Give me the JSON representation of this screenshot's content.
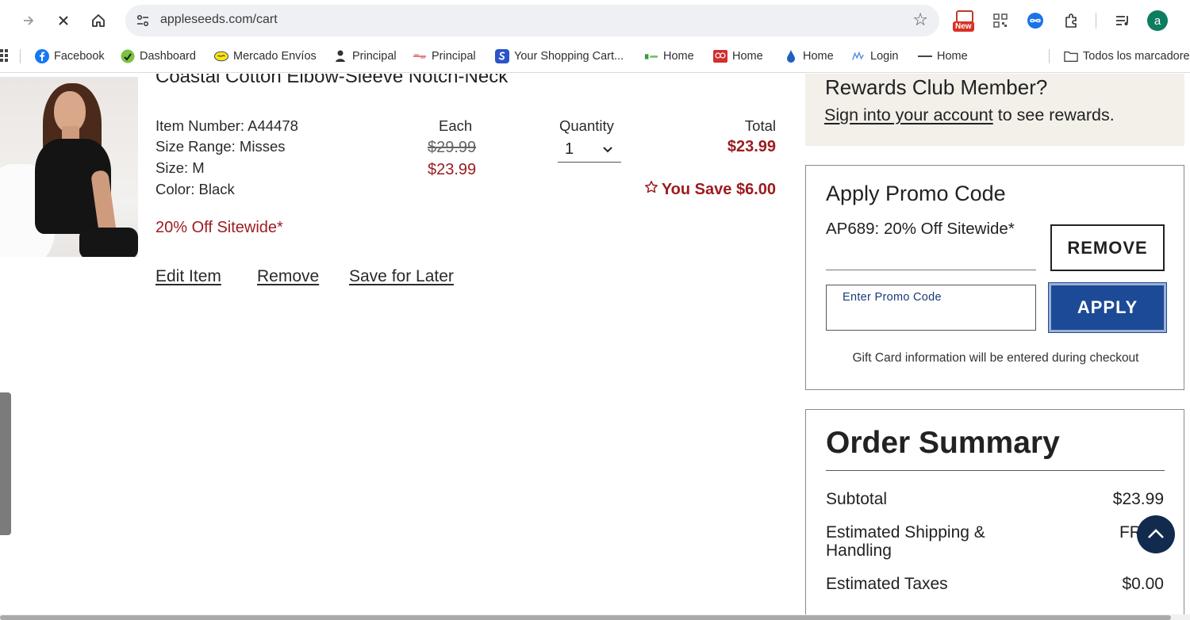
{
  "browser": {
    "url": "appleseeds.com/cart",
    "new_badge": "New",
    "profile_initial": "a",
    "bookmarks": [
      {
        "label": "Facebook",
        "icon": "facebook-icon"
      },
      {
        "label": "Dashboard",
        "icon": "dashboard-icon"
      },
      {
        "label": "Mercado Envíos",
        "icon": "mercado-icon"
      },
      {
        "label": "Principal",
        "icon": "principal-icon"
      },
      {
        "label": "Principal",
        "icon": "principal2-icon"
      },
      {
        "label": "Your Shopping Cart...",
        "icon": "cart-s-icon"
      },
      {
        "label": "Home",
        "icon": "home-green-icon"
      },
      {
        "label": "Home",
        "icon": "home-red-icon"
      },
      {
        "label": "Home",
        "icon": "drop-icon"
      },
      {
        "label": "Login",
        "icon": "login-icon"
      },
      {
        "label": "Home",
        "icon": "dash-icon"
      },
      {
        "label": "Todos los marcadores",
        "icon": "folder-icon"
      }
    ]
  },
  "cart_item": {
    "title": "Coastal Cotton Elbow-Sleeve Notch-Neck",
    "item_number": "Item Number: A44478",
    "size_range": "Size Range: Misses",
    "size": "Size: M",
    "color": "Color: Black",
    "each_label": "Each",
    "quantity_label": "Quantity",
    "total_label": "Total",
    "original_price": "$29.99",
    "sale_price": "$23.99",
    "quantity": "1",
    "total": "$23.99",
    "you_save": "You Save $6.00",
    "promo_note": "20% Off Sitewide*",
    "actions": {
      "edit": "Edit Item",
      "remove": "Remove",
      "save_later": "Save for Later"
    }
  },
  "rewards": {
    "question": "Rewards Club Member?",
    "sign_in_link": "Sign into your account",
    "sign_in_suffix": " to see rewards."
  },
  "promo": {
    "title": "Apply Promo Code",
    "applied_code": "AP689: 20% Off Sitewide*",
    "remove_label": "REMOVE",
    "input_placeholder": "Enter Promo Code",
    "apply_label": "APPLY",
    "gift_note": "Gift Card information will be entered during checkout"
  },
  "summary": {
    "title": "Order Summary",
    "rows": [
      {
        "label": "Subtotal",
        "value": "$23.99"
      },
      {
        "label": "Estimated Shipping & Handling",
        "value": "FREE"
      },
      {
        "label": "Estimated Taxes",
        "value": "$0.00"
      }
    ]
  },
  "colors": {
    "accent_red": "#9b1b1f",
    "apply_blue": "#1d4a96",
    "scroll_top_navy": "#132a4f",
    "rewards_bg": "#f3efe9"
  }
}
